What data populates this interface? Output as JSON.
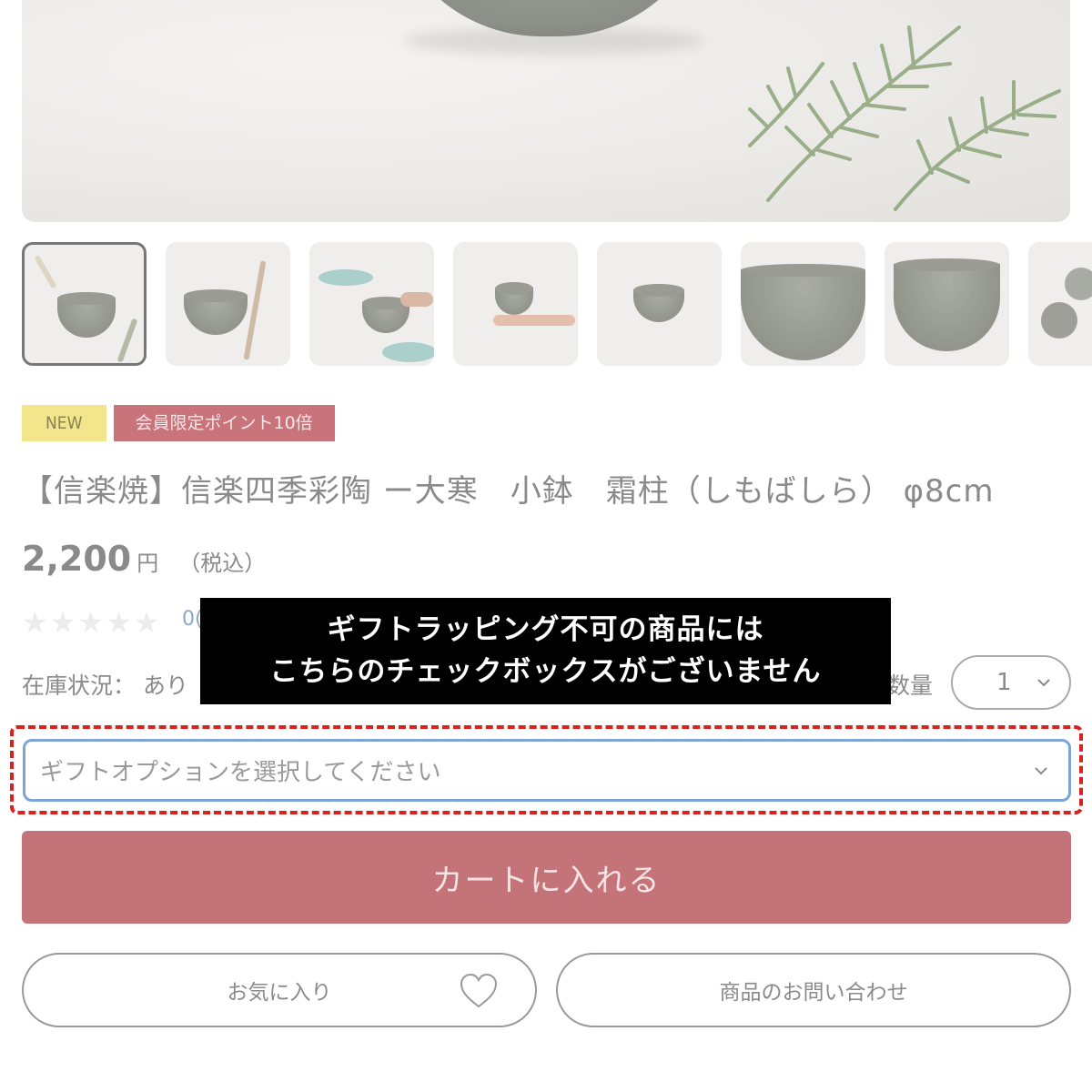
{
  "product": {
    "badge_new": "NEW",
    "badge_point": "会員限定ポイント10倍",
    "title": "【信楽焼】信楽四季彩陶 ー大寒　小鉢　霜柱（しもばしら） φ8cm",
    "price": "2,200",
    "price_unit": "円",
    "price_tax": "（税込）",
    "rating_stars": "★★★★★",
    "review_count": "0(",
    "stock_label": "在庫状況：",
    "stock_value": "あり"
  },
  "quantity": {
    "label": "数量",
    "value": "1"
  },
  "notice": {
    "line1": "ギフトラッピング不可の商品には",
    "line2": "こちらのチェックボックスがございません"
  },
  "gift_option": {
    "placeholder": "ギフトオプションを選択してください"
  },
  "buttons": {
    "add_to_cart": "カートに入れる",
    "favorite": "お気に入り",
    "contact": "商品のお問い合わせ"
  },
  "icons": {
    "chevron": "chevron-down-icon",
    "heart": "heart-icon"
  },
  "colors": {
    "accent": "#c47478",
    "badge_new": "#f3e58c",
    "highlight": "#d9211e",
    "select_border": "#7ea3d6"
  }
}
